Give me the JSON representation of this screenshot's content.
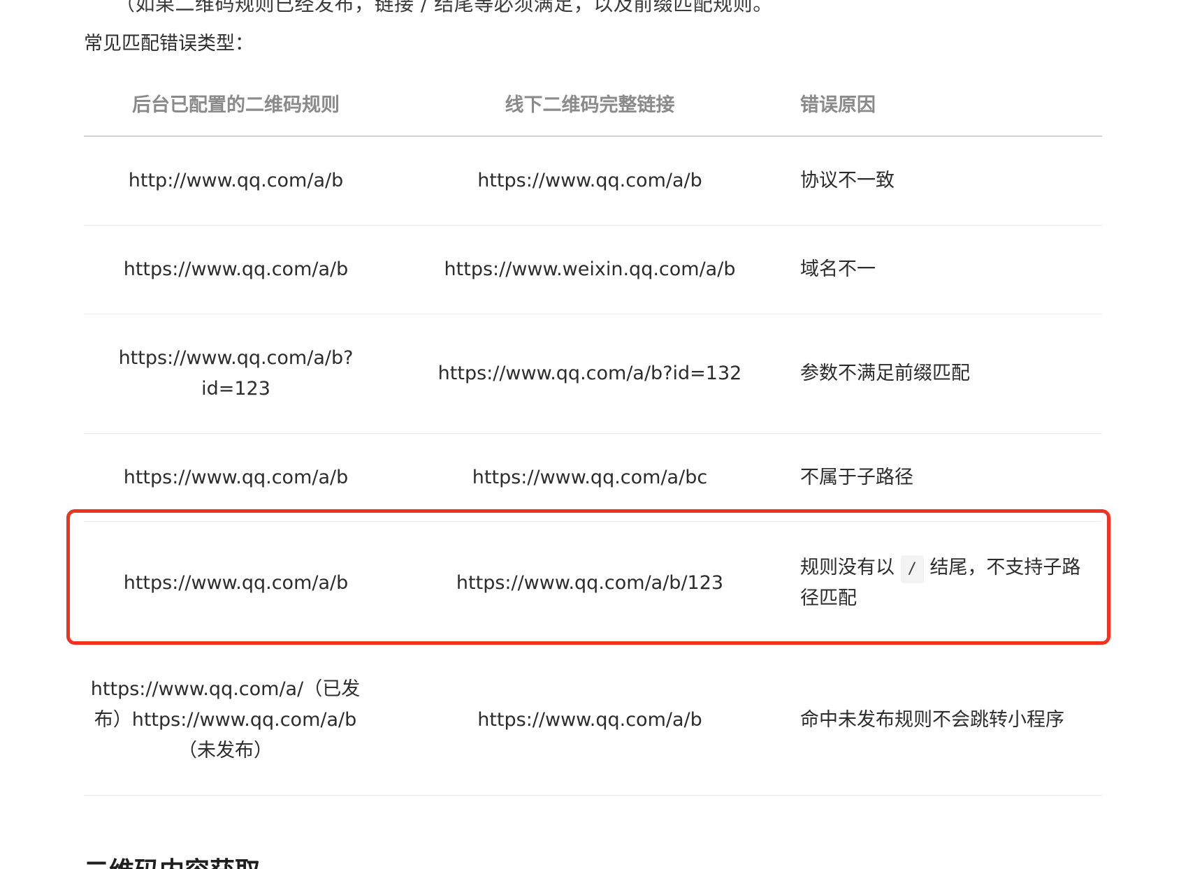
{
  "cut_line_text": "（如果二维码规则已经发布，链接 / 结尾等必须满足，以及前缀匹配规则。",
  "section_intro": "常见匹配错误类型：",
  "table": {
    "headers": [
      "后台已配置的二维码规则",
      "线下二维码完整链接",
      "错误原因"
    ],
    "rows": [
      {
        "rule": "http://www.qq.com/a/b",
        "link": "https://www.qq.com/a/b",
        "reason": "协议不一致"
      },
      {
        "rule": "https://www.qq.com/a/b",
        "link": "https://www.weixin.qq.com/a/b",
        "reason": "域名不一"
      },
      {
        "rule": "https://www.qq.com/a/b?id=123",
        "link": "https://www.qq.com/a/b?id=132",
        "reason": "参数不满足前缀匹配"
      },
      {
        "rule": "https://www.qq.com/a/b",
        "link": "https://www.qq.com/a/bc",
        "reason": "不属于子路径"
      },
      {
        "rule": "https://www.qq.com/a/b",
        "link": "https://www.qq.com/a/b/123",
        "reason_prefix": "规则没有以",
        "reason_code": "/",
        "reason_suffix": "结尾，不支持子路径匹配"
      },
      {
        "rule": "https://www.qq.com/a/（已发布）https://www.qq.com/a/b（未发布）",
        "link": "https://www.qq.com/a/b",
        "reason": "命中未发布规则不会跳转小程序"
      }
    ]
  },
  "next_heading": "二维码内容获取",
  "colors": {
    "highlight_border": "#f0321e",
    "header_text": "#8a8a8a",
    "body_text": "#2c2c2c"
  }
}
